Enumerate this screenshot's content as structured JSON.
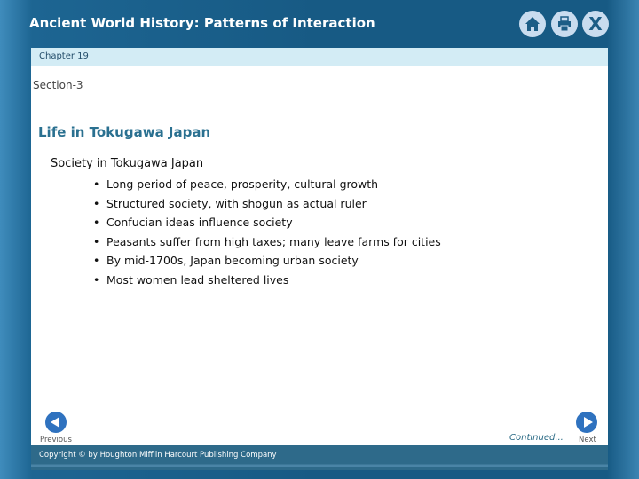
{
  "header": {
    "title": "Ancient World History: Patterns of Interaction",
    "icons": [
      "home-icon",
      "print-icon",
      "close-icon"
    ],
    "close_label": "X"
  },
  "chapter": "Chapter 19",
  "section": "Section-3",
  "heading": "Life in Tokugawa Japan",
  "subheading": "Society in Tokugawa Japan",
  "bullets": [
    "Long period of peace, prosperity, cultural growth",
    "Structured society, with shogun as actual ruler",
    "Confucian ideas influence society",
    "Peasants suffer from high taxes; many leave farms for cities",
    "By mid-1700s, Japan becoming urban society",
    "Most women lead sheltered lives"
  ],
  "nav": {
    "previous": "Previous",
    "next": "Next",
    "continued": "Continued..."
  },
  "footer": "Copyright © by Houghton Mifflin Harcourt Publishing Company"
}
